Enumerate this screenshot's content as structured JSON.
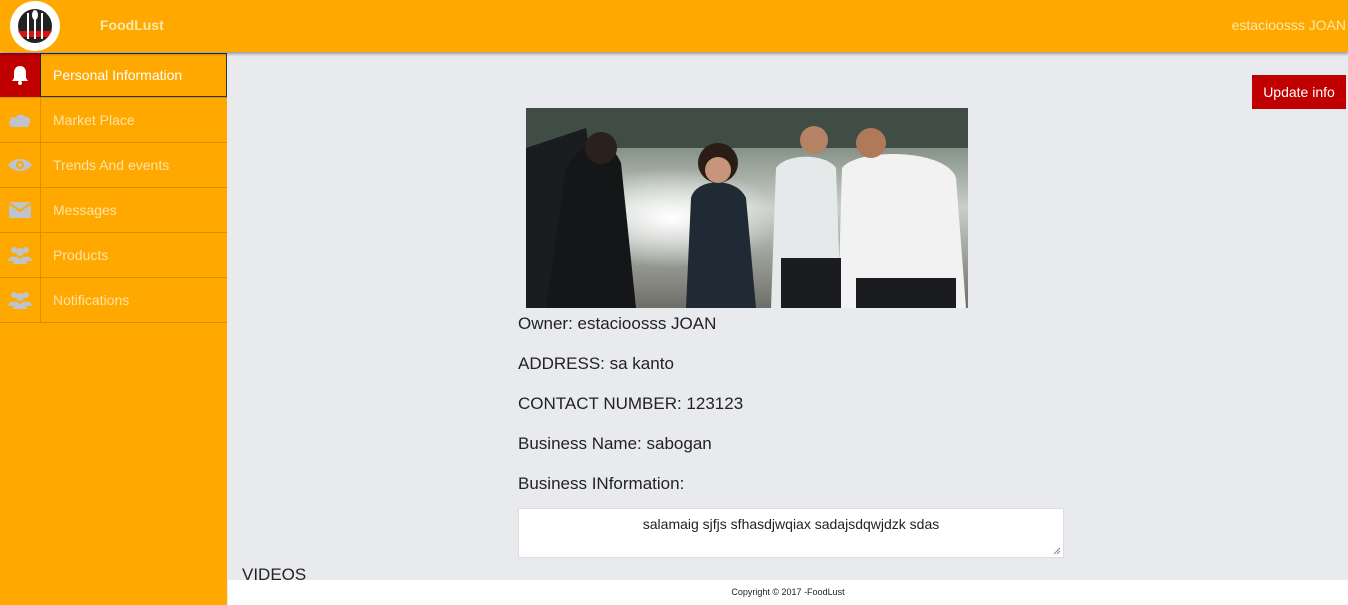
{
  "header": {
    "brand": "FoodLust",
    "username": "estacioosss JOAN"
  },
  "sidebar": {
    "items": [
      {
        "label": "Personal Information",
        "icon": "bell-icon",
        "active": true
      },
      {
        "label": "Market Place",
        "icon": "cloud-icon",
        "active": false
      },
      {
        "label": "Trends And events",
        "icon": "eye-icon",
        "active": false
      },
      {
        "label": "Messages",
        "icon": "envelope-icon",
        "active": false
      },
      {
        "label": "Products",
        "icon": "users-icon",
        "active": false
      },
      {
        "label": "Notifications",
        "icon": "users-icon",
        "active": false
      }
    ]
  },
  "main": {
    "update_button": "Update info",
    "owner": "Owner: estacioosss JOAN",
    "address": "ADDRESS: sa kanto",
    "contact": "CONTACT NUMBER: 123123",
    "business_name": "Business Name: sabogan",
    "business_info_label": "Business INformation:",
    "business_info_value": "salamaig sjfjs sfhasdjwqiax sadajsdqwjdzk sdas",
    "videos_label": "VIDEOS"
  },
  "footer": {
    "copyright": "Copyright © 2017 -FoodLust"
  },
  "colors": {
    "primary": "#ffa800",
    "accent": "#c00000",
    "background": "#e9eaee"
  }
}
